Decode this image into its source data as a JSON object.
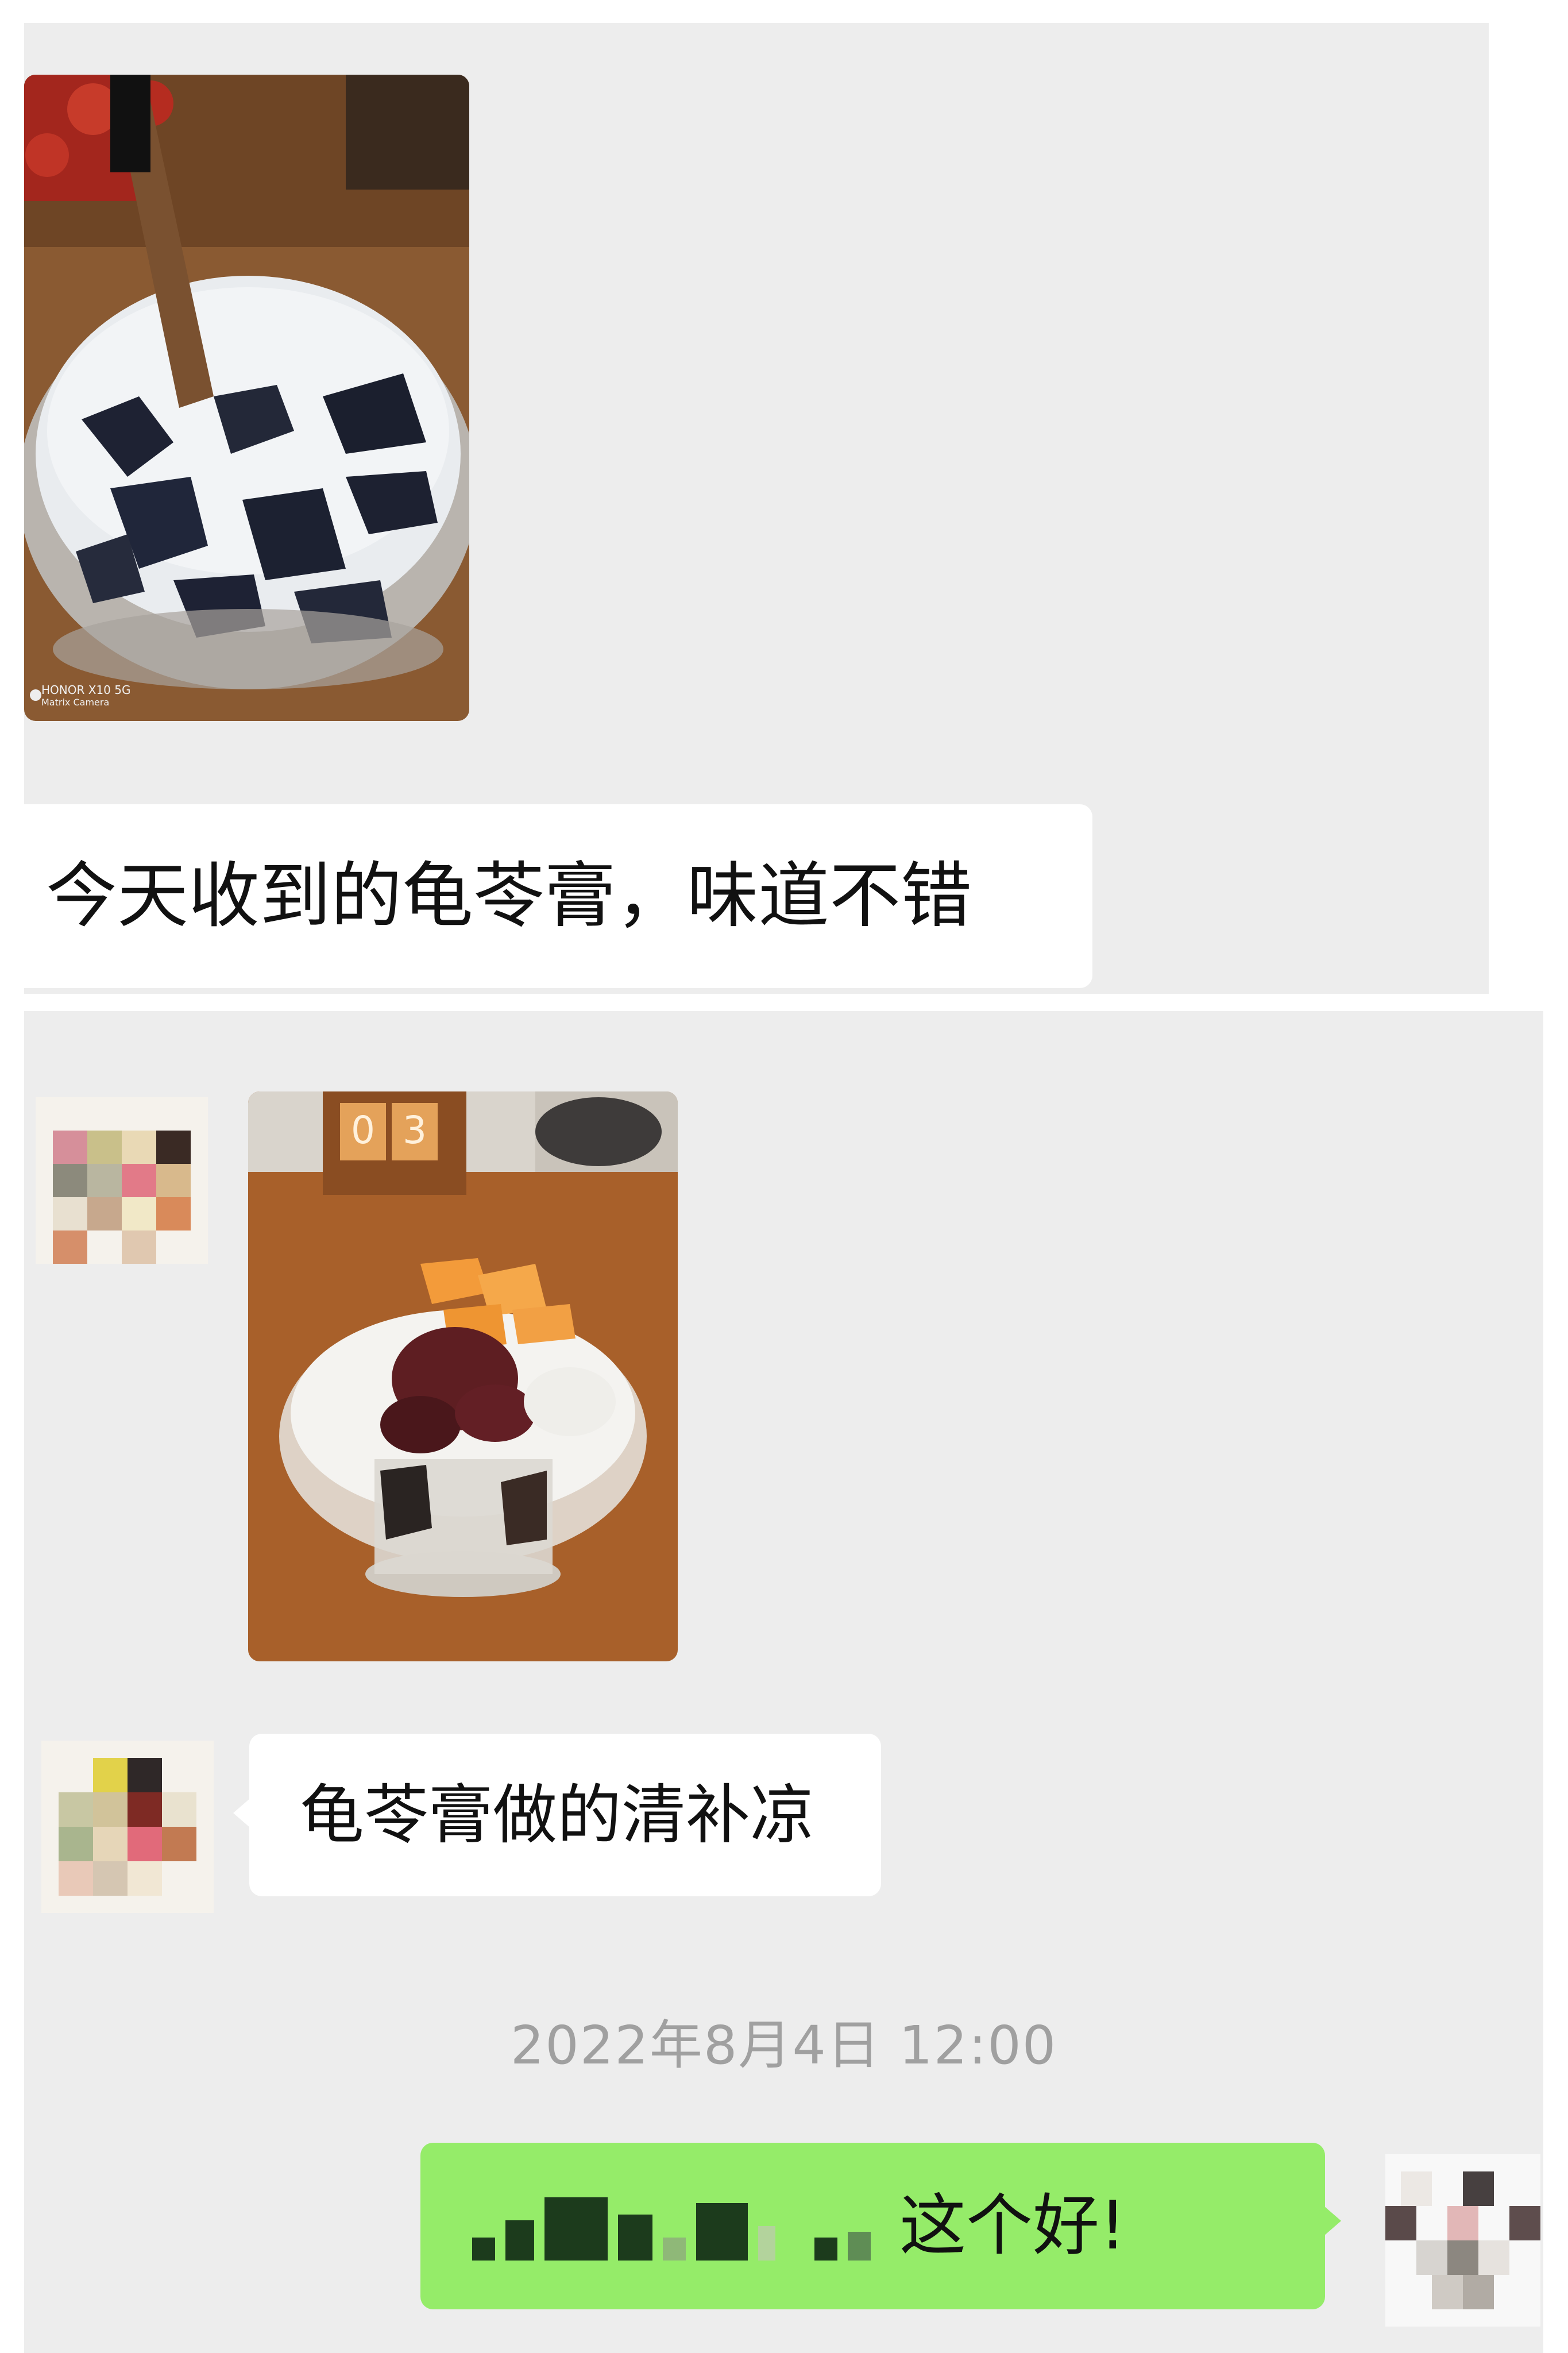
{
  "panel1": {
    "photo": {
      "name": "grass-jelly-milk-photo",
      "watermark_line1": "HONOR X10 5G",
      "watermark_line2": "Matrix Camera"
    },
    "message_text": "今天收到的龟苓膏，味道不错"
  },
  "panel2": {
    "photo": {
      "name": "grass-jelly-dessert-photo",
      "calendar_digits": [
        "0",
        "3"
      ]
    },
    "message_text": "龟苓膏做的清补凉",
    "timestamp": "2022年8月4日 12:00",
    "reply_text": "这个好!"
  },
  "colors": {
    "chat_background": "#ededed",
    "bubble_white": "#ffffff",
    "bubble_green": "#95ec69",
    "timestamp_gray": "#a0a0a0"
  }
}
